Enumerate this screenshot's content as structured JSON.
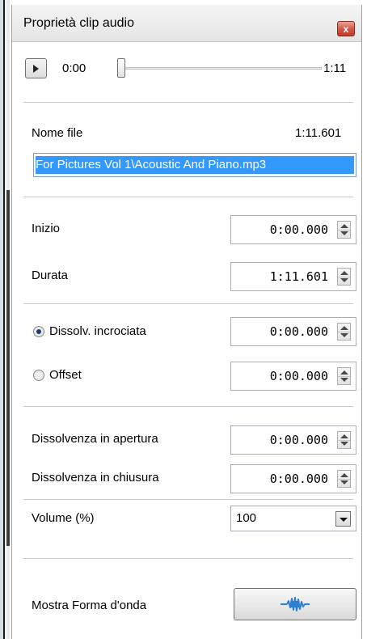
{
  "dialog": {
    "title": "Proprietà clip audio",
    "close_label": "x"
  },
  "player": {
    "current_time": "0:00",
    "total_time": "1:11",
    "position_fraction": 0.0
  },
  "file": {
    "label": "Nome file",
    "duration": "1:11.601",
    "path": "For Pictures Vol 1\\Acoustic And Piano.mp3"
  },
  "timing": {
    "start_label": "Inizio",
    "start_value": "0:00.000",
    "duration_label": "Durata",
    "duration_value": "1:11.601"
  },
  "transition": {
    "crossfade_label": "Dissolv. incrociata",
    "crossfade_value": "0:00.000",
    "crossfade_selected": true,
    "offset_label": "Offset",
    "offset_value": "0:00.000",
    "offset_selected": false
  },
  "fades": {
    "fade_in_label": "Dissolvenza in apertura",
    "fade_in_value": "0:00.000",
    "fade_out_label": "Dissolvenza in chiusura",
    "fade_out_value": "0:00.000"
  },
  "volume": {
    "label": "Volume (%)",
    "value": "100"
  },
  "waveform": {
    "label": "Mostra Forma d'onda",
    "icon": "waveform-icon"
  },
  "colors": {
    "selection": "#3399ff",
    "waveform": "#2f7fd0"
  }
}
